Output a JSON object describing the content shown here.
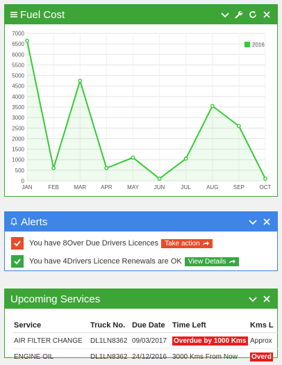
{
  "fuel": {
    "title": "Fuel Cost",
    "icons": [
      "menu-icon",
      "chevron-down-icon",
      "wrench-icon",
      "refresh-icon",
      "close-icon"
    ]
  },
  "chart_data": {
    "type": "area",
    "title": "",
    "xlabel": "",
    "ylabel": "",
    "categories": [
      "JAN",
      "FEB",
      "MAR",
      "APR",
      "MAY",
      "JUN",
      "JUL",
      "AUG",
      "SEP",
      "OCT"
    ],
    "series": [
      {
        "name": "2016",
        "values": [
          6650,
          600,
          4750,
          600,
          1100,
          100,
          1050,
          3550,
          2600,
          100
        ],
        "color": "#33cc33"
      }
    ],
    "ylim": [
      0,
      7000
    ],
    "yticks": [
      0,
      500,
      1000,
      1500,
      2000,
      2500,
      3000,
      3500,
      4000,
      4500,
      5000,
      5500,
      6000,
      6500,
      7000
    ],
    "grid": true,
    "legend": "top-right"
  },
  "alerts": {
    "title": "Alerts",
    "items": [
      {
        "text": "You have 8Over Due Drivers Licences",
        "button": "Take action",
        "color": "#e64c2a"
      },
      {
        "text": "You have 4Drivers Licence Renewals are OK",
        "button": "View Details",
        "color": "#36a842"
      }
    ]
  },
  "services": {
    "title": "Upcoming Services",
    "columns": [
      "Service",
      "Truck No.",
      "Due Date",
      "Time Left",
      "Kms L"
    ],
    "rows": [
      [
        "AIR FILTER CHANGE",
        "DL1LN8362",
        "09/03/2017",
        "Overdue by 1000 Kms",
        "Approx"
      ],
      [
        "ENGINE OIL",
        "DL1LN8362",
        "24/12/2016",
        "3000 Kms From Now",
        "Overd"
      ]
    ]
  }
}
